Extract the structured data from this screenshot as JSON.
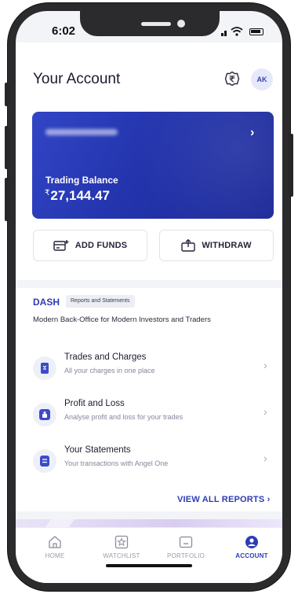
{
  "status_bar": {
    "time": "6:02"
  },
  "header": {
    "title": "Your Account",
    "avatar_initials": "AK"
  },
  "balance_card": {
    "label": "Trading Balance",
    "currency_symbol": "₹",
    "amount": "27,144.47"
  },
  "actions": {
    "add_funds": "ADD FUNDS",
    "withdraw": "WITHDRAW"
  },
  "dash": {
    "title": "DASH",
    "badge": "Reports and Statements",
    "description": "Modern Back-Office for Modern Investors and Traders",
    "reports": [
      {
        "title": "Trades and Charges",
        "subtitle": "All your charges in one place"
      },
      {
        "title": "Profit and Loss",
        "subtitle": "Analyse profit and loss for your trades"
      },
      {
        "title": "Your Statements",
        "subtitle": "Your transactions with Angel One"
      }
    ],
    "view_all": "VIEW ALL REPORTS"
  },
  "bottom_nav": [
    {
      "label": "HOME",
      "icon": "home-icon"
    },
    {
      "label": "WATCHLIST",
      "icon": "star-icon"
    },
    {
      "label": "PORTFOLIO",
      "icon": "portfolio-icon"
    },
    {
      "label": "ACCOUNT",
      "icon": "account-icon",
      "active": true
    }
  ],
  "colors": {
    "accent": "#2d3bb5",
    "card": "#2334ad",
    "muted": "#9a9cab"
  }
}
